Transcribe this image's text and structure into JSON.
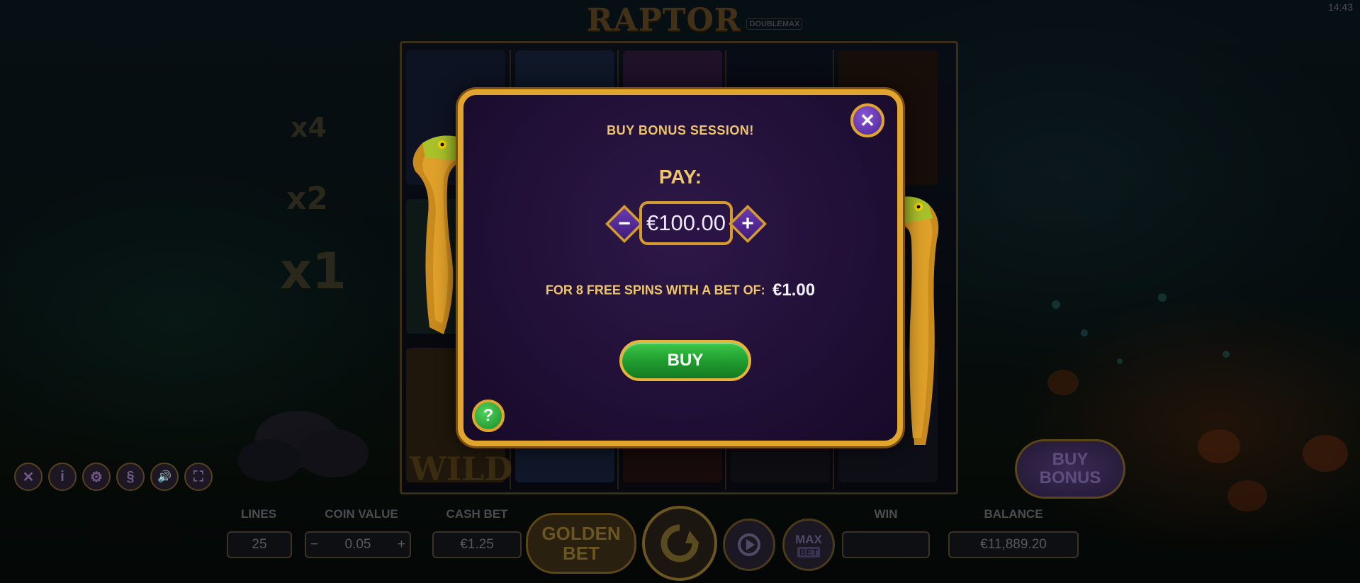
{
  "clock": "14:43",
  "logo": {
    "main": "RAPTOR",
    "sub": "DOUBLEMAX"
  },
  "multipliers": [
    "x4",
    "x2",
    "x1"
  ],
  "wild_label": "WILD",
  "toolbar_icons": [
    "close-icon",
    "info-icon",
    "gear-icon",
    "paragraph-icon",
    "speaker-icon",
    "fullscreen-icon"
  ],
  "toolbar_glyphs": [
    "✕",
    "i",
    "⚙",
    "§",
    "🔊",
    "⛶"
  ],
  "buy_bonus_button": "BUY\nBONUS",
  "bottom": {
    "lines": {
      "label": "LINES",
      "value": "25"
    },
    "coin_value": {
      "label": "COIN VALUE",
      "value": "0.05",
      "minus": "−",
      "plus": "+"
    },
    "cash_bet": {
      "label": "CASH BET",
      "value": "€1.25"
    },
    "golden_bet": "GOLDEN BET",
    "max_bet": {
      "top": "MAX",
      "bottom": "BET"
    },
    "win": {
      "label": "WIN",
      "value": ""
    },
    "balance": {
      "label": "BALANCE",
      "value": "€11,889.20"
    }
  },
  "dialog": {
    "title": "BUY BONUS SESSION!",
    "pay_label": "PAY:",
    "amount": "€100.00",
    "minus": "−",
    "plus": "+",
    "info_label": "FOR 8 FREE SPINS WITH A BET OF:",
    "info_value": "€1.00",
    "buy_label": "BUY",
    "close_glyph": "✕",
    "help_glyph": "?"
  },
  "colors": {
    "dialog_border": "#e1a52e",
    "dialog_bg": "#200f36",
    "title_gold": "#efc66a",
    "buy_green": "#1f9a2e",
    "stepper_purple": "#5a2aa0"
  }
}
